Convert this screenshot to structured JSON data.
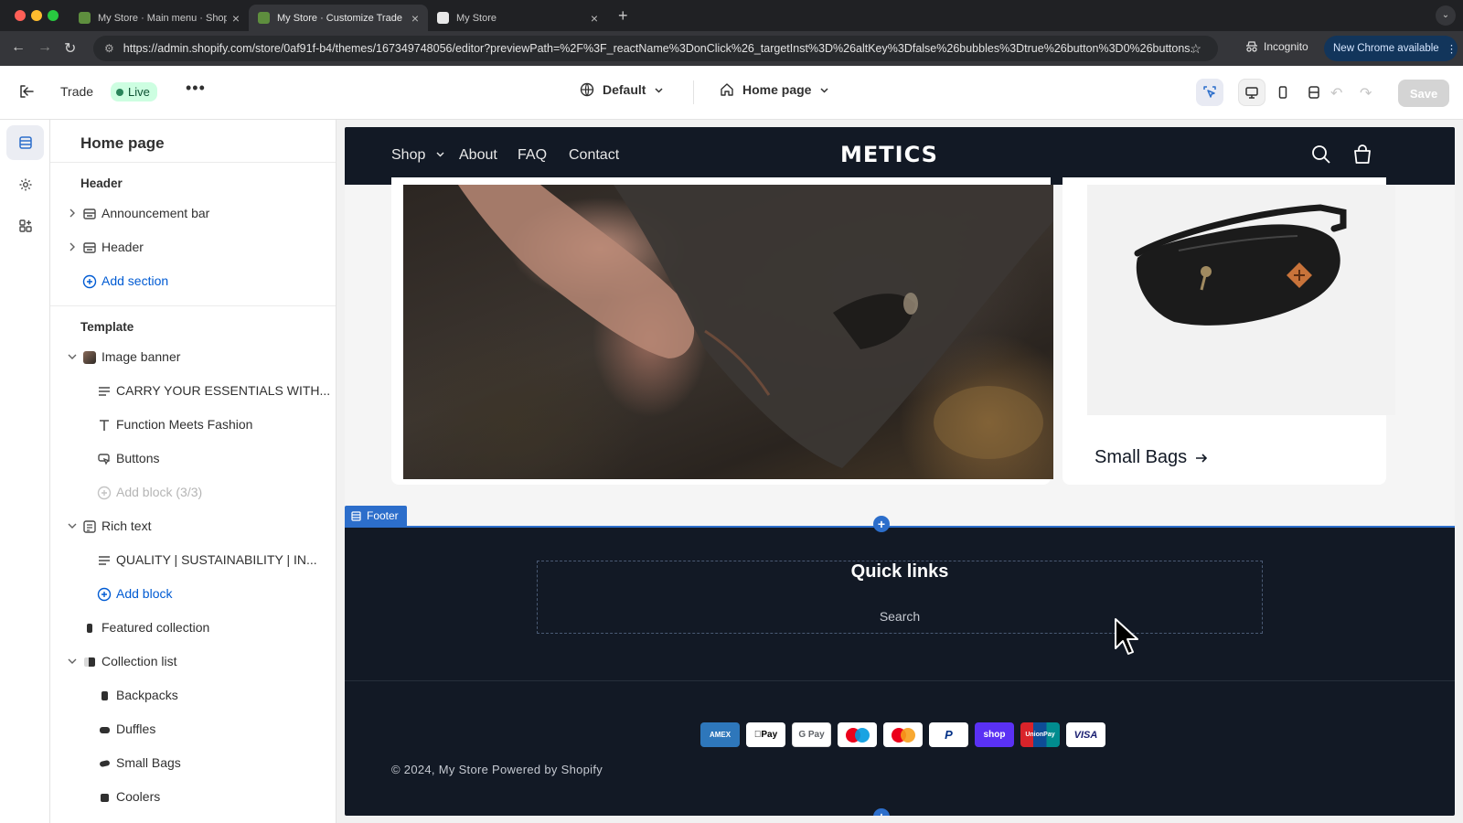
{
  "browser": {
    "tabs": [
      {
        "label": "My Store · Main menu · Shopify",
        "active": false
      },
      {
        "label": "My Store · Customize Trade · Shopify",
        "active": true
      },
      {
        "label": "My Store",
        "active": false
      }
    ],
    "url": "https://admin.shopify.com/store/0af91f-b4/themes/167349748056/editor?previewPath=%2F%3F_reactName%3DonClick%26_targetInst%3D%26altKey%3Dfalse%26bubbles%3Dtrue%26button%3D0%26buttons...",
    "incognito_label": "Incognito",
    "update_label": "New Chrome available"
  },
  "editor": {
    "theme_name": "Trade",
    "status_badge": "Live",
    "theme_setting": "Default",
    "page_setting": "Home page",
    "save_label": "Save"
  },
  "sidebar": {
    "title": "Home page",
    "header_group": "Header",
    "header_items": [
      {
        "label": "Announcement bar"
      },
      {
        "label": "Header"
      }
    ],
    "header_add": "Add section",
    "template_group": "Template",
    "template_items": [
      {
        "label": "Image banner",
        "level": 0,
        "expanded": true
      },
      {
        "label": "CARRY YOUR ESSENTIALS WITH...",
        "level": 1
      },
      {
        "label": "Function Meets Fashion",
        "level": 1
      },
      {
        "label": "Buttons",
        "level": 1
      },
      {
        "label": "Add block (3/3)",
        "level": 1,
        "disabled": true
      },
      {
        "label": "Rich text",
        "level": 0,
        "expanded": true
      },
      {
        "label": "QUALITY | SUSTAINABILITY | IN...",
        "level": 1
      },
      {
        "label": "Add block",
        "level": 1,
        "link": true
      },
      {
        "label": "Featured collection",
        "level": 0
      },
      {
        "label": "Collection list",
        "level": 0,
        "expanded": true
      },
      {
        "label": "Backpacks",
        "level": 1
      },
      {
        "label": "Duffles",
        "level": 1
      },
      {
        "label": "Small Bags",
        "level": 1
      },
      {
        "label": "Coolers",
        "level": 1
      }
    ]
  },
  "store": {
    "nav": [
      "Shop",
      "About",
      "FAQ",
      "Contact"
    ],
    "logo": "METICS",
    "collection_card_title": "Small Bags",
    "footer_tag": "Footer",
    "footer_heading": "Quick links",
    "footer_link": "Search",
    "payment_methods": [
      "American Express",
      "Apple Pay",
      "Google Pay",
      "Maestro",
      "Mastercard",
      "PayPal",
      "Shop Pay",
      "UnionPay",
      "Visa"
    ],
    "copyright": "© 2024, My Store Powered by Shopify"
  },
  "colors": {
    "accent_blue": "#2c6ecb",
    "store_dark": "#121925",
    "live_green": "#29845a"
  }
}
